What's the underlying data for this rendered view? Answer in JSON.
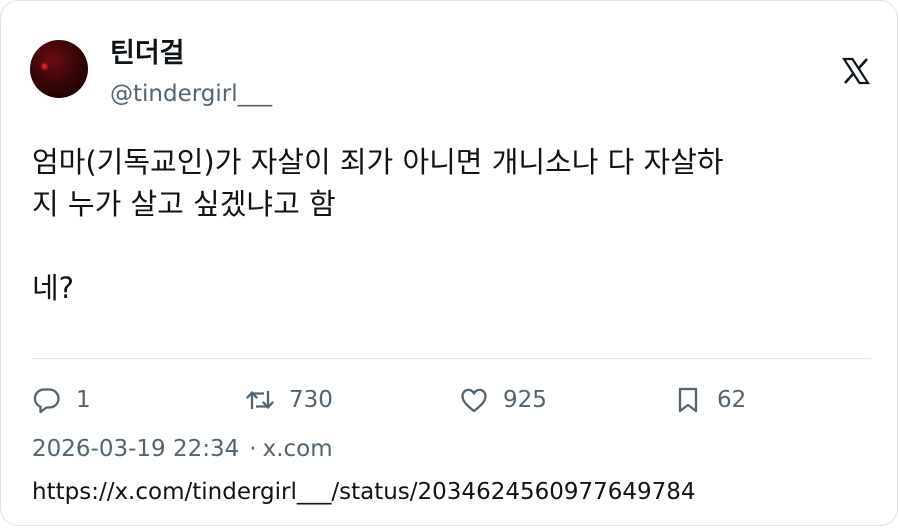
{
  "author": {
    "display_name": "틴더걸",
    "handle": "@tindergirl___"
  },
  "brand": {
    "logo_icon": "x-logo-icon"
  },
  "tweet": {
    "text": "엄마(기독교인)가 자살이 죄가 아니면 개니소나 다 자살하\n지 누가 살고 싶겠냐고 함\n\n네?"
  },
  "actions": {
    "reply": {
      "icon": "reply-icon",
      "count": "1"
    },
    "retweet": {
      "icon": "retweet-icon",
      "count": "730"
    },
    "like": {
      "icon": "heart-icon",
      "count": "925"
    },
    "bookmark": {
      "icon": "bookmark-icon",
      "count": "62"
    }
  },
  "meta": {
    "timestamp": "2026-03-19 22:34",
    "separator": "·",
    "source": "x.com"
  },
  "link": {
    "url": "https://x.com/tindergirl___/status/2034624560977649784"
  },
  "colors": {
    "text_primary": "#0f1419",
    "text_secondary": "#536471",
    "border": "#dfe3e6",
    "divider": "#e7e9ea",
    "avatar": "#3a0507"
  }
}
